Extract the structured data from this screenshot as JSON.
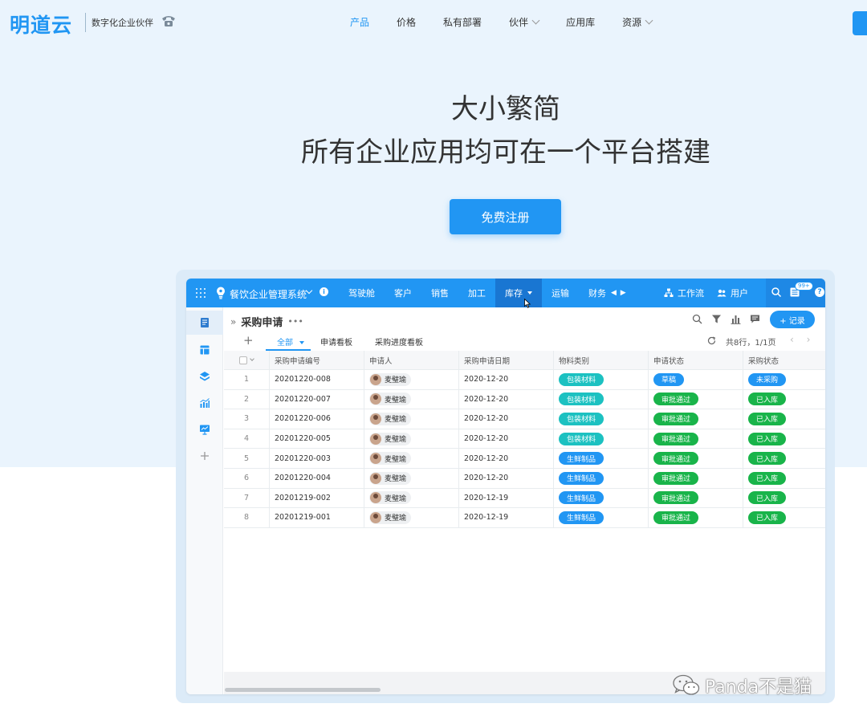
{
  "site": {
    "logo": "明道云",
    "slogan": "数字化企业伙伴",
    "nav": [
      {
        "label": "产品",
        "active": true,
        "dropdown": false
      },
      {
        "label": "价格",
        "active": false,
        "dropdown": false
      },
      {
        "label": "私有部署",
        "active": false,
        "dropdown": false
      },
      {
        "label": "伙伴",
        "active": false,
        "dropdown": true
      },
      {
        "label": "应用库",
        "active": false,
        "dropdown": false
      },
      {
        "label": "资源",
        "active": false,
        "dropdown": true
      }
    ],
    "accent": "#2196f3"
  },
  "hero": {
    "title1": "大小繁简",
    "title2": "所有企业应用均可在一个平台搭建",
    "cta": "免费注册"
  },
  "app": {
    "name": "餐饮企业管理系统",
    "tabs": [
      {
        "label": "驾驶舱"
      },
      {
        "label": "客户"
      },
      {
        "label": "销售"
      },
      {
        "label": "加工"
      },
      {
        "label": "库存",
        "active": true
      },
      {
        "label": "运输"
      },
      {
        "label": "财务"
      }
    ],
    "workflow": "工作流",
    "users": "用户",
    "badge": "99+",
    "help": "?",
    "info": "i"
  },
  "view": {
    "title": "采购申请",
    "add_record": "+ 记录",
    "tabs": [
      "全部",
      "申请看板",
      "采购进度看板"
    ],
    "pager": "共8行，1/1页",
    "pager_arrows": "‹ ›"
  },
  "table": {
    "columns": [
      "采购申请编号",
      "申请人",
      "采购申请日期",
      "物料类别",
      "申请状态",
      "采购状态"
    ],
    "rows": [
      {
        "no": "1",
        "id": "20201220-008",
        "applicant": "麦璧瑜",
        "date": "2020-12-20",
        "category": "包装材料",
        "status": "草稿",
        "purchase": "未采购"
      },
      {
        "no": "2",
        "id": "20201220-007",
        "applicant": "麦璧瑜",
        "date": "2020-12-20",
        "category": "包装材料",
        "status": "审批通过",
        "purchase": "已入库"
      },
      {
        "no": "3",
        "id": "20201220-006",
        "applicant": "麦璧瑜",
        "date": "2020-12-20",
        "category": "包装材料",
        "status": "审批通过",
        "purchase": "已入库"
      },
      {
        "no": "4",
        "id": "20201220-005",
        "applicant": "麦璧瑜",
        "date": "2020-12-20",
        "category": "包装材料",
        "status": "审批通过",
        "purchase": "已入库"
      },
      {
        "no": "5",
        "id": "20201220-003",
        "applicant": "麦璧瑜",
        "date": "2020-12-20",
        "category": "生鲜制品",
        "status": "审批通过",
        "purchase": "已入库"
      },
      {
        "no": "6",
        "id": "20201220-004",
        "applicant": "麦璧瑜",
        "date": "2020-12-20",
        "category": "生鲜制品",
        "status": "审批通过",
        "purchase": "已入库"
      },
      {
        "no": "7",
        "id": "20201219-002",
        "applicant": "麦璧瑜",
        "date": "2020-12-19",
        "category": "生鲜制品",
        "status": "审批通过",
        "purchase": "已入库"
      },
      {
        "no": "8",
        "id": "20201219-001",
        "applicant": "麦璧瑜",
        "date": "2020-12-19",
        "category": "生鲜制品",
        "status": "审批通过",
        "purchase": "已入库"
      }
    ],
    "pill_colors": {
      "包装材料": "#1cc1c1",
      "生鲜制品": "#2196f3",
      "草稿": "#2196f3",
      "审批通过": "#19b44a",
      "未采购": "#2196f3",
      "已入库": "#19b44a"
    }
  },
  "watermark": "Panda不是猫"
}
